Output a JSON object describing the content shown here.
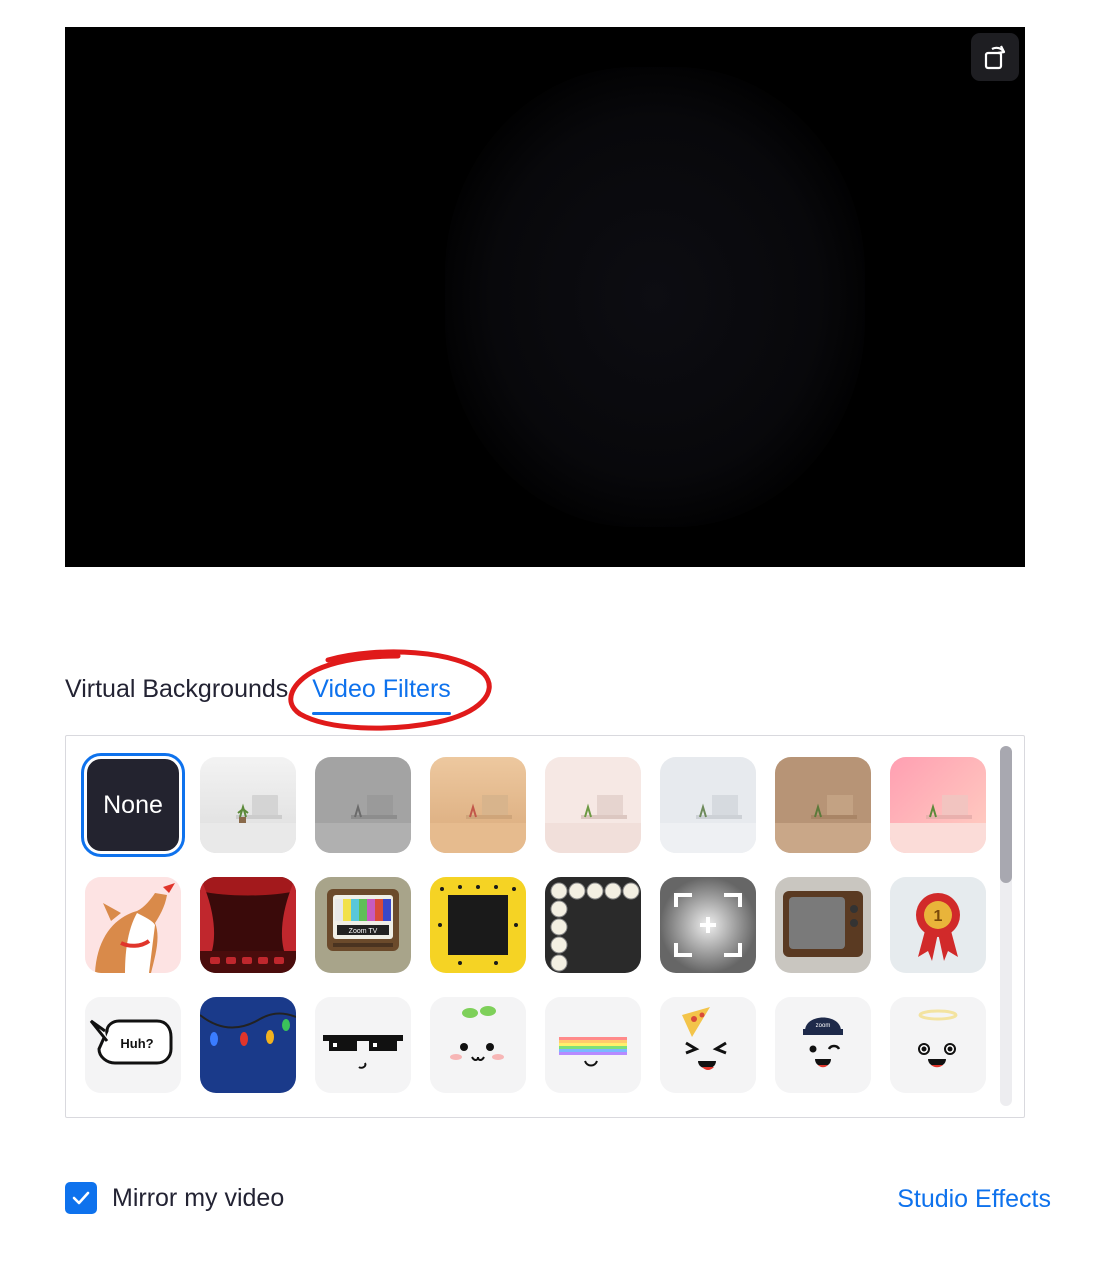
{
  "preview": {
    "rotate_icon": "rotate-camera-icon"
  },
  "tabs": [
    {
      "label": "Virtual Backgrounds",
      "active": false
    },
    {
      "label": "Video Filters",
      "active": true
    }
  ],
  "colors": {
    "accent": "#0e72ed",
    "annotation": "#e01a1a",
    "none_tile": "#23232f"
  },
  "filters": {
    "none_label": "None",
    "row1": [
      "white-room",
      "gray-room",
      "tan-room",
      "blush-room",
      "silver-room",
      "brown-room",
      "pink-room"
    ],
    "row2": [
      "corgi",
      "theater-curtains",
      "retro-tv",
      "emoji-frame",
      "bulb-frame",
      "camera-frame",
      "old-tv",
      "first-place-ribbon"
    ],
    "row3_bubble_text": "Huh?",
    "row3": [
      "speech-bubble",
      "string-lights",
      "pixel-sunglasses",
      "sprout",
      "rainbow",
      "pizza-hat",
      "zoom-cap",
      "halo"
    ],
    "retro_tv_label": "Zoom TV",
    "ribbon_number": "1",
    "cap_text": "zoom"
  },
  "mirror": {
    "label": "Mirror my video",
    "checked": true
  },
  "studio_effects": {
    "label": "Studio Effects"
  }
}
